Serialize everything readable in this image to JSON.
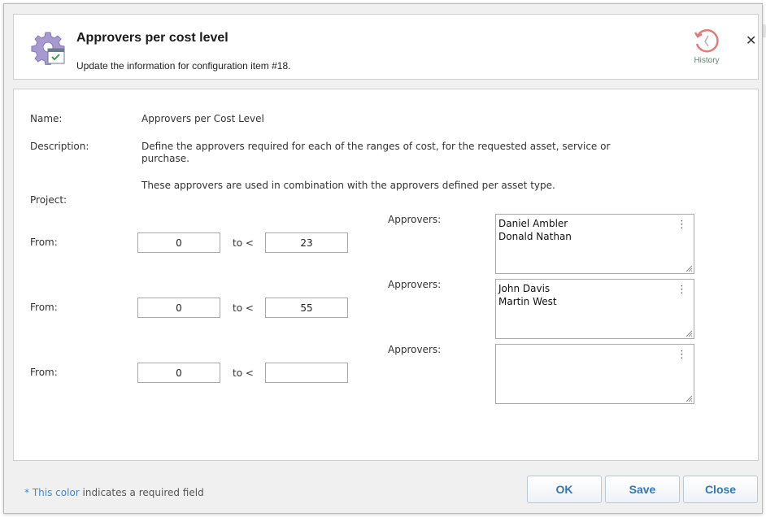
{
  "header": {
    "title": "Approvers per cost level",
    "subtitle": "Update the information for configuration item #18.",
    "history_label": "History",
    "close_symbol": "✕"
  },
  "form": {
    "name_label": "Name:",
    "name_value": "Approvers per Cost Level",
    "description_label": "Description:",
    "description_p1": "Define the approvers required for each of the ranges of cost, for the requested asset, service or purchase.",
    "description_p2": "These approvers are used in combination with the approvers defined per asset type.",
    "project_label": "Project:",
    "ranges": [
      {
        "from_label": "From:",
        "from_value": "0",
        "to_label": "to <",
        "to_value": "23",
        "approvers_label": "Approvers:",
        "approvers": [
          "Daniel Ambler",
          "Donald Nathan"
        ]
      },
      {
        "from_label": "From:",
        "from_value": "0",
        "to_label": "to <",
        "to_value": "55",
        "approvers_label": "Approvers:",
        "approvers": [
          "John Davis",
          "Martin West"
        ]
      },
      {
        "from_label": "From:",
        "from_value": "0",
        "to_label": "to <",
        "to_value": "",
        "approvers_label": "Approvers:",
        "approvers": []
      }
    ],
    "menu_symbol": "⋮"
  },
  "footer": {
    "required_star": "*",
    "required_color_text": "This color",
    "required_note_rest": "indicates a required field",
    "ok_label": "OK",
    "save_label": "Save",
    "close_label": "Close"
  },
  "colors": {
    "accent": "#3576b6",
    "required": "#3d8bd0",
    "history_icon": "#e07b7b"
  },
  "icons": {
    "header_icon": "gear-calendar-icon",
    "history_icon": "history-clock-icon",
    "close_icon": "close-icon",
    "menu_icon": "vertical-ellipsis-icon"
  }
}
